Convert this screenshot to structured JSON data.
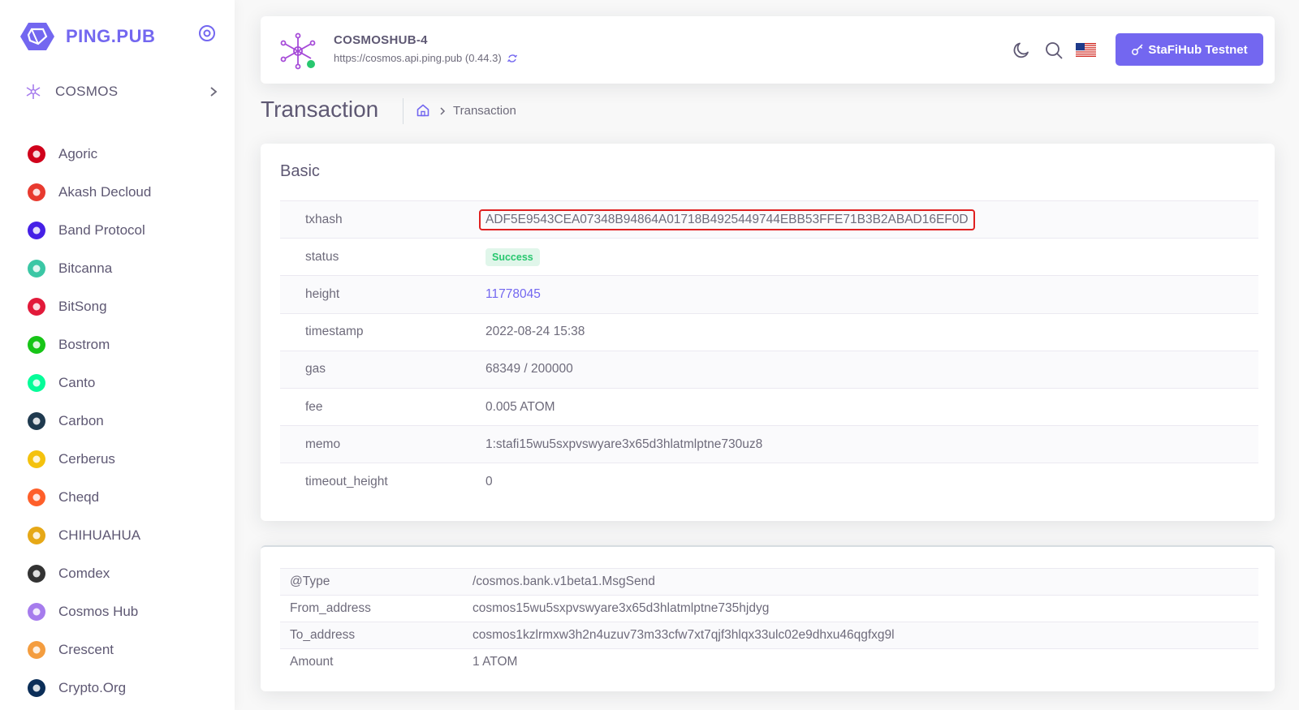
{
  "brand": {
    "name": "PING.PUB"
  },
  "nav": {
    "head_label": "COSMOS"
  },
  "chains": [
    {
      "label": "Agoric",
      "color": "#d0021b",
      "icon": "agoric-icon"
    },
    {
      "label": "Akash Decloud",
      "color": "#e83a2f",
      "icon": "akash-icon"
    },
    {
      "label": "Band Protocol",
      "color": "#4520e6",
      "icon": "band-icon"
    },
    {
      "label": "Bitcanna",
      "color": "#3bc7a5",
      "icon": "bitcanna-icon"
    },
    {
      "label": "BitSong",
      "color": "#e21a3a",
      "icon": "bitsong-icon"
    },
    {
      "label": "Bostrom",
      "color": "#17c517",
      "icon": "bostrom-icon"
    },
    {
      "label": "Canto",
      "color": "#06fc99",
      "icon": "canto-icon"
    },
    {
      "label": "Carbon",
      "color": "#1f3a4f",
      "icon": "carbon-icon"
    },
    {
      "label": "Cerberus",
      "color": "#f4c20d",
      "icon": "cerberus-icon"
    },
    {
      "label": "Cheqd",
      "color": "#fe5f2a",
      "icon": "cheqd-icon"
    },
    {
      "label": "CHIHUAHUA",
      "color": "#e6a817",
      "icon": "chihuahua-icon"
    },
    {
      "label": "Comdex",
      "color": "#333333",
      "icon": "comdex-icon"
    },
    {
      "label": "Cosmos Hub",
      "color": "#a67ced",
      "icon": "cosmos-hub-icon"
    },
    {
      "label": "Crescent",
      "color": "#f49d3f",
      "icon": "crescent-icon"
    },
    {
      "label": "Crypto.Org",
      "color": "#0b2e58",
      "icon": "crypto-org-icon"
    }
  ],
  "header": {
    "chain_name": "COSMOSHUB-4",
    "api_url": "https://cosmos.api.ping.pub (0.44.3)",
    "wallet_label": "StaFiHub Testnet"
  },
  "page": {
    "title": "Transaction",
    "breadcrumb_current": "Transaction"
  },
  "basic": {
    "title": "Basic",
    "rows": {
      "txhash": {
        "key": "txhash",
        "value": "ADF5E9543CEA07348B94864A01718B4925449744EBB53FFE71B3B2ABAD16EF0D"
      },
      "status": {
        "key": "status",
        "value": "Success"
      },
      "height": {
        "key": "height",
        "value": "11778045"
      },
      "timestamp": {
        "key": "timestamp",
        "value": "2022-08-24 15:38"
      },
      "gas": {
        "key": "gas",
        "value": "68349 / 200000"
      },
      "fee": {
        "key": "fee",
        "value": "0.005 ATOM"
      },
      "memo": {
        "key": "memo",
        "value": "1:stafi15wu5sxpvswyare3x65d3hlatmlptne730uz8"
      },
      "timeout_height": {
        "key": "timeout_height",
        "value": "0"
      }
    }
  },
  "message": {
    "rows": [
      {
        "key": "@Type",
        "value": "/cosmos.bank.v1beta1.MsgSend"
      },
      {
        "key": "From_address",
        "value": "cosmos15wu5sxpvswyare3x65d3hlatmlptne735hjdyg"
      },
      {
        "key": "To_address",
        "value": "cosmos1kzlrmxw3h2n4uzuv73m33cfw7xt7qjf3hlqx33ulc02e9dhxu46qgfxg9l"
      },
      {
        "key": "Amount",
        "value": "1 ATOM"
      }
    ]
  },
  "colors": {
    "accent": "#7367f0",
    "success": "#28c76f"
  }
}
